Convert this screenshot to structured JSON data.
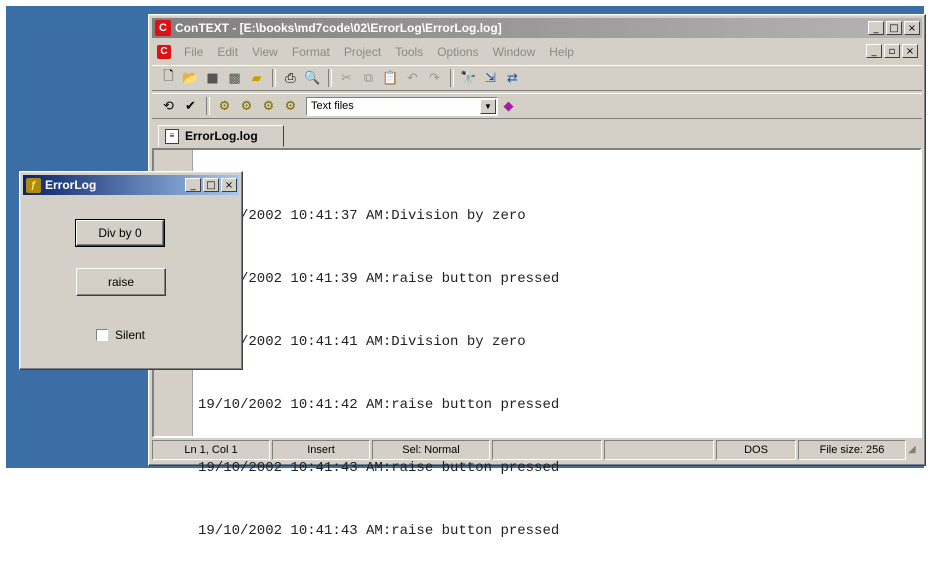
{
  "main_window": {
    "title": "ConTEXT - [E:\\books\\md7code\\02\\ErrorLog\\ErrorLog.log]",
    "app_icon": "C",
    "caption_buttons": [
      "_",
      "□",
      "×"
    ],
    "mdi_buttons": [
      "_",
      "▫",
      "×"
    ],
    "menu": [
      "File",
      "Edit",
      "View",
      "Format",
      "Project",
      "Tools",
      "Options",
      "Window",
      "Help"
    ],
    "toolbar1_icons": [
      "new-file",
      "open-folder",
      "save",
      "save-all",
      "open-project",
      "print",
      "print-preview",
      "cut",
      "copy",
      "paste",
      "undo",
      "redo",
      "find",
      "find-next",
      "replace"
    ],
    "toolbar2_icons": [
      "history",
      "check",
      "user-exec-1",
      "user-exec-2",
      "user-exec-3",
      "user-exec-4"
    ],
    "filter_combo": {
      "value": "Text files"
    },
    "tab": {
      "label": "ErrorLog.log"
    },
    "log_lines": [
      "19/10/2002 10:41:37 AM:Division by zero",
      "19/10/2002 10:41:39 AM:raise button pressed",
      "19/10/2002 10:41:41 AM:Division by zero",
      "19/10/2002 10:41:42 AM:raise button pressed",
      "19/10/2002 10:41:43 AM:raise button pressed",
      "19/10/2002 10:41:43 AM:raise button pressed"
    ],
    "status": {
      "position": "Ln 1, Col 1",
      "mode": "Insert",
      "selection": "Sel: Normal",
      "format": "DOS",
      "file_size": "File size: 256"
    }
  },
  "dialog": {
    "title": "ErrorLog",
    "caption_buttons": [
      "_",
      "□",
      "×"
    ],
    "div_button": "Div by 0",
    "raise_button": "raise",
    "silent_checkbox": {
      "label": "Silent",
      "checked": false
    }
  }
}
